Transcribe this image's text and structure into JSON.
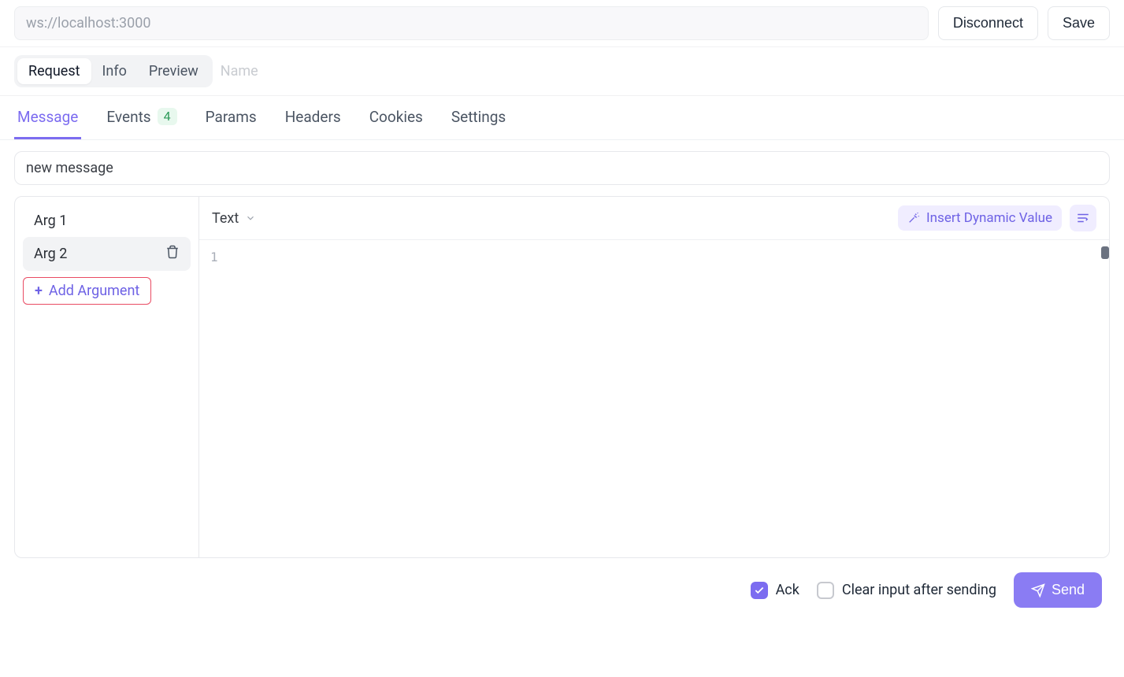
{
  "top": {
    "url": "ws://localhost:3000",
    "disconnect": "Disconnect",
    "save": "Save"
  },
  "view_tabs": {
    "request": "Request",
    "info": "Info",
    "preview": "Preview",
    "name_placeholder": "Name"
  },
  "section_tabs": {
    "message": "Message",
    "events": "Events",
    "events_badge": "4",
    "params": "Params",
    "headers": "Headers",
    "cookies": "Cookies",
    "settings": "Settings"
  },
  "event_name": "new message",
  "args": {
    "items": [
      "Arg 1",
      "Arg 2"
    ],
    "add_label": "Add Argument"
  },
  "editor": {
    "type_label": "Text",
    "insert_label": "Insert Dynamic Value",
    "line_number": "1"
  },
  "footer": {
    "ack": "Ack",
    "clear": "Clear input after sending",
    "send": "Send",
    "ack_checked": true,
    "clear_checked": false
  },
  "colors": {
    "accent": "#7c6cf0",
    "badge_bg": "#e8f8ee",
    "badge_fg": "#2e9b5a",
    "danger_border": "#e94b63"
  }
}
